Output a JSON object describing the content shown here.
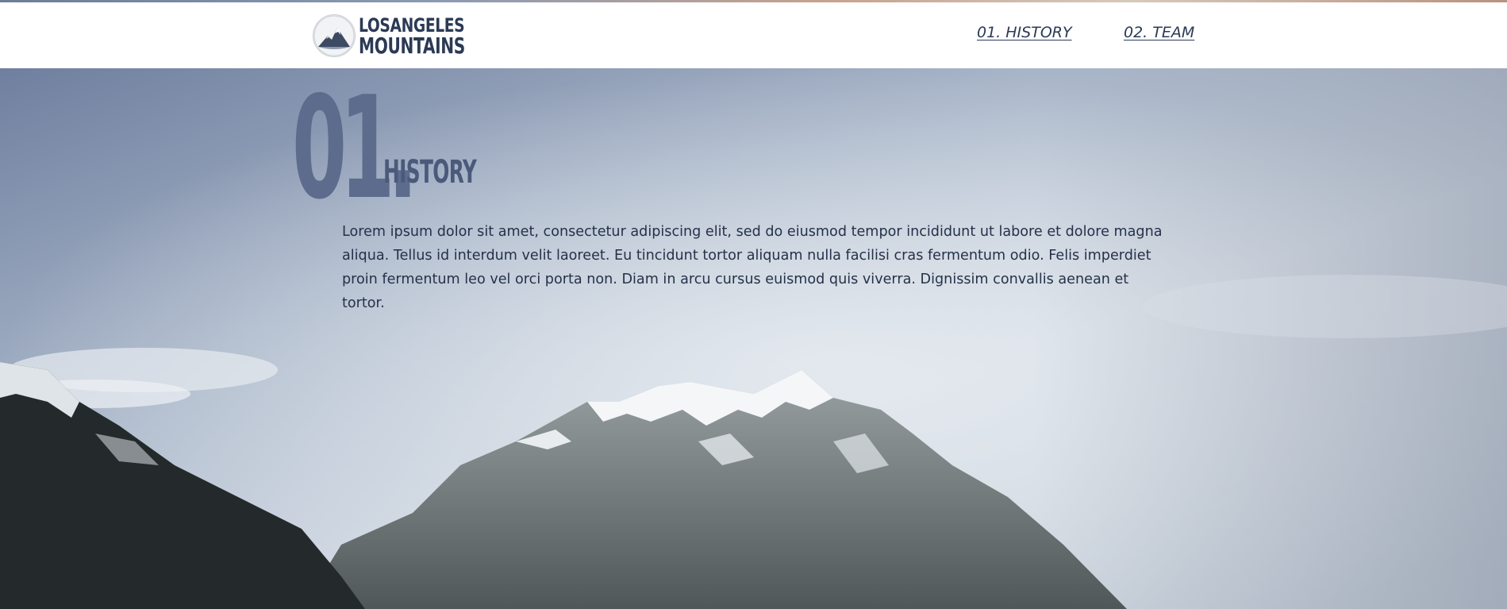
{
  "header": {
    "logo": {
      "line1": "LOSANGELES",
      "line2": "MOUNTAINS",
      "icon": "mountain-logo-icon"
    },
    "nav": [
      {
        "label": "01. HISTORY"
      },
      {
        "label": "02. TEAM"
      }
    ]
  },
  "section": {
    "number": "01.",
    "title": "HISTORY",
    "body": "Lorem ipsum dolor sit amet, consectetur adipiscing elit, sed do eiusmod tempor incididunt ut labore et dolore magna aliqua. Tellus id interdum velit laoreet. Eu tincidunt tortor aliquam nulla facilisi cras fermentum odio. Felis imperdiet proin fermentum leo vel orci porta non. Diam in arcu cursus euismod quis viverra. Dignissim convallis aenean et tortor."
  },
  "colors": {
    "text": "#2b3a55",
    "number": "#5d6c8c",
    "body_text": "#25314a",
    "header_bg": "#ffffff"
  }
}
